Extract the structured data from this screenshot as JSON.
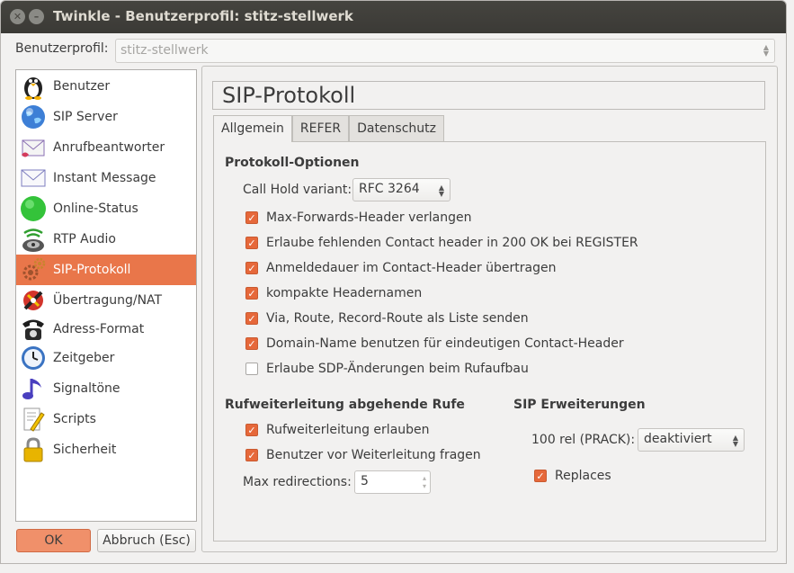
{
  "window": {
    "title": "Twinkle - Benutzerprofil: stitz-stellwerk"
  },
  "profile": {
    "label": "Benutzerprofil:",
    "value": "stitz-stellwerk"
  },
  "sidebar": {
    "items": [
      {
        "label": "Benutzer",
        "icon": "penguin-icon"
      },
      {
        "label": "SIP Server",
        "icon": "globe-icon"
      },
      {
        "label": "Anrufbeantworter",
        "icon": "voicemail-icon"
      },
      {
        "label": "Instant Message",
        "icon": "envelope-icon"
      },
      {
        "label": "Online-Status",
        "icon": "status-green-icon"
      },
      {
        "label": "RTP Audio",
        "icon": "speaker-icon"
      },
      {
        "label": "SIP-Protokoll",
        "icon": "gear-icon",
        "selected": true
      },
      {
        "label": "Übertragung/NAT",
        "icon": "network-icon"
      },
      {
        "label": "Adress-Format",
        "icon": "telephone-icon"
      },
      {
        "label": "Zeitgeber",
        "icon": "clock-icon"
      },
      {
        "label": "Signaltöne",
        "icon": "music-note-icon"
      },
      {
        "label": "Scripts",
        "icon": "script-icon"
      },
      {
        "label": "Sicherheit",
        "icon": "lock-icon"
      }
    ]
  },
  "page": {
    "title": "SIP-Protokoll"
  },
  "tabs": [
    {
      "label": "Allgemein",
      "active": true
    },
    {
      "label": "REFER",
      "active": false
    },
    {
      "label": "Datenschutz",
      "active": false
    }
  ],
  "protocol_options": {
    "heading": "Protokoll-Optionen",
    "call_hold_label": "Call Hold variant:",
    "call_hold_value": "RFC 3264",
    "checks": [
      {
        "label": "Max-Forwards-Header verlangen",
        "checked": true
      },
      {
        "label": "Erlaube fehlenden Contact header in 200 OK bei REGISTER",
        "checked": true
      },
      {
        "label": "Anmeldedauer im Contact-Header übertragen",
        "checked": true
      },
      {
        "label": "kompakte Headernamen",
        "checked": true
      },
      {
        "label": "Via, Route, Record-Route als Liste senden",
        "checked": true
      },
      {
        "label": "Domain-Name benutzen für eindeutigen Contact-Header",
        "checked": true
      },
      {
        "label": "Erlaube SDP-Änderungen beim Rufaufbau",
        "checked": false
      }
    ]
  },
  "forwarding": {
    "heading": "Rufweiterleitung abgehende Rufe",
    "checks": [
      {
        "label": "Rufweiterleitung erlauben",
        "checked": true
      },
      {
        "label": "Benutzer vor Weiterleitung fragen",
        "checked": true
      }
    ],
    "max_redirections_label": "Max redirections:",
    "max_redirections_value": "5"
  },
  "sip_extensions": {
    "heading": "SIP Erweiterungen",
    "rel100_label": "100 rel (PRACK):",
    "rel100_value": "deaktiviert",
    "replaces_label": "Replaces",
    "replaces_checked": true
  },
  "buttons": {
    "ok": "OK",
    "cancel": "Abbruch (Esc)"
  },
  "colors": {
    "accent": "#e9764a",
    "checkbox": "#e6683a",
    "titlebar": "#3b3a36"
  }
}
